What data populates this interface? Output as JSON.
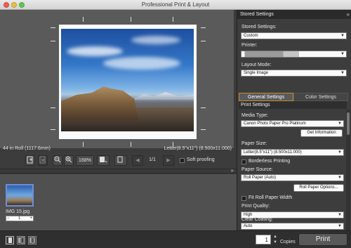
{
  "window": {
    "title": "Professional Print & Layout"
  },
  "preview": {
    "roll_info": "44 in Roll (1117.6mm)",
    "paper_info": "Letter(8.5\"x11\") (8.500x11.000)"
  },
  "toolbar": {
    "zoom_value": "168%",
    "page_indicator": "1/1",
    "soft_proofing_label": "Soft proofing"
  },
  "thumbnails": [
    {
      "name": "IMG 15.jpg",
      "copies": "1"
    }
  ],
  "bottom": {
    "copies_value": "1",
    "copies_label": "Copies",
    "print_label": "Print"
  },
  "panel": {
    "header": "Stored Settings",
    "stored_settings": {
      "label": "Stored Settings:",
      "value": "Custom"
    },
    "printer": {
      "label": "Printer:"
    },
    "layout_mode": {
      "label": "Layout Mode:",
      "value": "Single Image"
    },
    "tabs": [
      "General Settings",
      "Color Settings"
    ],
    "print_settings_header": "Print Settings",
    "media_type": {
      "label": "Media Type:",
      "value": "Canon Photo Paper Pro Platinum"
    },
    "get_information": "Get Information",
    "paper_size": {
      "label": "Paper Size:",
      "value": "Letter(8.5\"x11\") (8.500x11.000)"
    },
    "borderless_printing": "Borderless Printing",
    "paper_source": {
      "label": "Paper Source:",
      "value": "Roll Paper (Auto)"
    },
    "roll_paper_options": "Roll Paper Options...",
    "fit_roll_paper_width": "Fit Roll Paper Width",
    "print_quality": {
      "label": "Print Quality:",
      "value": "High"
    },
    "clear_coating": {
      "label": "Clear Coating:",
      "value": "Auto"
    }
  },
  "colors": {
    "accent_tab_border": "#c98a2e",
    "thumb_selection": "#6f8fd6"
  }
}
